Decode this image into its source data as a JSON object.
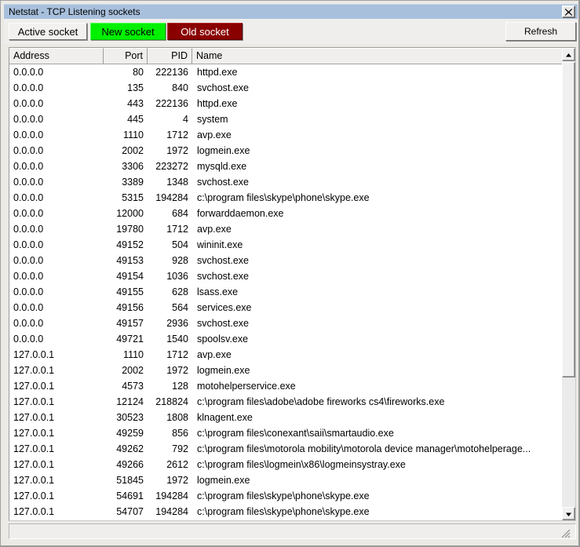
{
  "window": {
    "title": "Netstat - TCP Listening sockets",
    "close_icon": "close-icon"
  },
  "toolbar": {
    "active_socket_label": "Active socket",
    "new_socket_label": "New socket",
    "old_socket_label": "Old socket",
    "refresh_label": "Refresh",
    "colors": {
      "new_socket_bg": "#00f000",
      "new_socket_fg": "#000000",
      "old_socket_bg": "#8a0000",
      "old_socket_fg": "#ffffff",
      "button_bg": "#f2f1ef",
      "titlebar_bg": "#a8c0dc"
    }
  },
  "table": {
    "columns": [
      {
        "key": "address",
        "label": "Address",
        "align": "left"
      },
      {
        "key": "port",
        "label": "Port",
        "align": "right"
      },
      {
        "key": "pid",
        "label": "PID",
        "align": "right"
      },
      {
        "key": "name",
        "label": "Name",
        "align": "left"
      }
    ],
    "rows": [
      {
        "address": "0.0.0.0",
        "port": "80",
        "pid": "222136",
        "name": "httpd.exe"
      },
      {
        "address": "0.0.0.0",
        "port": "135",
        "pid": "840",
        "name": "svchost.exe"
      },
      {
        "address": "0.0.0.0",
        "port": "443",
        "pid": "222136",
        "name": "httpd.exe"
      },
      {
        "address": "0.0.0.0",
        "port": "445",
        "pid": "4",
        "name": "system"
      },
      {
        "address": "0.0.0.0",
        "port": "1110",
        "pid": "1712",
        "name": "avp.exe"
      },
      {
        "address": "0.0.0.0",
        "port": "2002",
        "pid": "1972",
        "name": "logmein.exe"
      },
      {
        "address": "0.0.0.0",
        "port": "3306",
        "pid": "223272",
        "name": "mysqld.exe"
      },
      {
        "address": "0.0.0.0",
        "port": "3389",
        "pid": "1348",
        "name": "svchost.exe"
      },
      {
        "address": "0.0.0.0",
        "port": "5315",
        "pid": "194284",
        "name": "c:\\program files\\skype\\phone\\skype.exe"
      },
      {
        "address": "0.0.0.0",
        "port": "12000",
        "pid": "684",
        "name": "forwarddaemon.exe"
      },
      {
        "address": "0.0.0.0",
        "port": "19780",
        "pid": "1712",
        "name": "avp.exe"
      },
      {
        "address": "0.0.0.0",
        "port": "49152",
        "pid": "504",
        "name": "wininit.exe"
      },
      {
        "address": "0.0.0.0",
        "port": "49153",
        "pid": "928",
        "name": "svchost.exe"
      },
      {
        "address": "0.0.0.0",
        "port": "49154",
        "pid": "1036",
        "name": "svchost.exe"
      },
      {
        "address": "0.0.0.0",
        "port": "49155",
        "pid": "628",
        "name": "lsass.exe"
      },
      {
        "address": "0.0.0.0",
        "port": "49156",
        "pid": "564",
        "name": "services.exe"
      },
      {
        "address": "0.0.0.0",
        "port": "49157",
        "pid": "2936",
        "name": "svchost.exe"
      },
      {
        "address": "0.0.0.0",
        "port": "49721",
        "pid": "1540",
        "name": "spoolsv.exe"
      },
      {
        "address": "127.0.0.1",
        "port": "1110",
        "pid": "1712",
        "name": "avp.exe"
      },
      {
        "address": "127.0.0.1",
        "port": "2002",
        "pid": "1972",
        "name": "logmein.exe"
      },
      {
        "address": "127.0.0.1",
        "port": "4573",
        "pid": "128",
        "name": "motohelperservice.exe"
      },
      {
        "address": "127.0.0.1",
        "port": "12124",
        "pid": "218824",
        "name": "c:\\program files\\adobe\\adobe fireworks cs4\\fireworks.exe"
      },
      {
        "address": "127.0.0.1",
        "port": "30523",
        "pid": "1808",
        "name": "klnagent.exe"
      },
      {
        "address": "127.0.0.1",
        "port": "49259",
        "pid": "856",
        "name": "c:\\program files\\conexant\\saii\\smartaudio.exe"
      },
      {
        "address": "127.0.0.1",
        "port": "49262",
        "pid": "792",
        "name": "c:\\program files\\motorola mobility\\motorola device manager\\motohelperage..."
      },
      {
        "address": "127.0.0.1",
        "port": "49266",
        "pid": "2612",
        "name": "c:\\program files\\logmein\\x86\\logmeinsystray.exe"
      },
      {
        "address": "127.0.0.1",
        "port": "51845",
        "pid": "1972",
        "name": "logmein.exe"
      },
      {
        "address": "127.0.0.1",
        "port": "54691",
        "pid": "194284",
        "name": "c:\\program files\\skype\\phone\\skype.exe"
      },
      {
        "address": "127.0.0.1",
        "port": "54707",
        "pid": "194284",
        "name": "c:\\program files\\skype\\phone\\skype.exe"
      }
    ]
  },
  "scrollbar": {
    "up_icon": "triangle-up-icon",
    "down_icon": "triangle-down-icon"
  }
}
